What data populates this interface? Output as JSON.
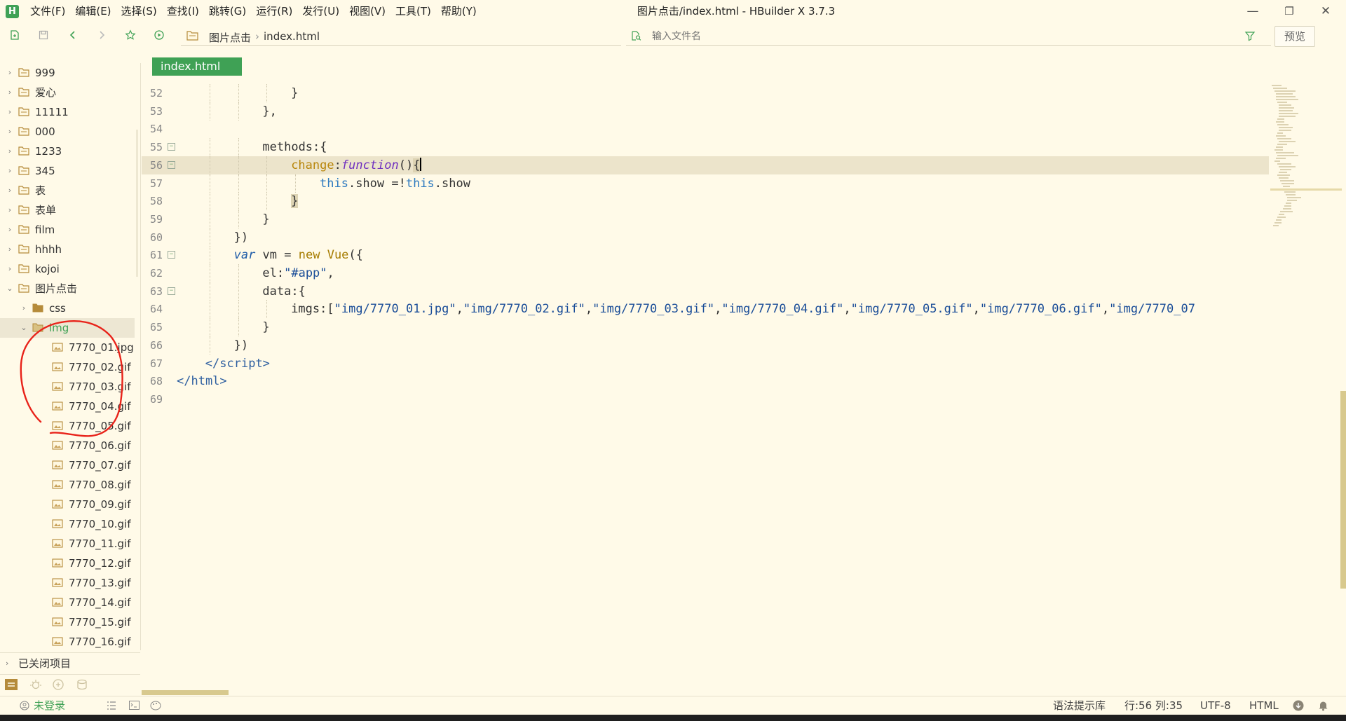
{
  "app": {
    "logo_letter": "H",
    "window_title": "图片点击/index.html - HBuilder X 3.7.3",
    "accent_color": "#3fa155"
  },
  "menu": [
    "文件(F)",
    "编辑(E)",
    "选择(S)",
    "查找(I)",
    "跳转(G)",
    "运行(R)",
    "发行(U)",
    "视图(V)",
    "工具(T)",
    "帮助(Y)"
  ],
  "window_controls": {
    "minimize": "—",
    "restore": "❐",
    "close": "✕"
  },
  "toolbar": {
    "breadcrumb": [
      "图片点击",
      "index.html"
    ],
    "breadcrumb_separator": "›",
    "search_placeholder": "输入文件名",
    "preview_label": "预览"
  },
  "sidebar": {
    "tree": [
      {
        "label": "999",
        "kind": "folder",
        "expanded": false,
        "depth": 0
      },
      {
        "label": "爱心",
        "kind": "folder",
        "expanded": false,
        "depth": 0
      },
      {
        "label": "11111",
        "kind": "folder",
        "expanded": false,
        "depth": 0
      },
      {
        "label": "000",
        "kind": "folder",
        "expanded": false,
        "depth": 0
      },
      {
        "label": "1233",
        "kind": "folder",
        "expanded": false,
        "depth": 0
      },
      {
        "label": "345",
        "kind": "folder",
        "expanded": false,
        "depth": 0
      },
      {
        "label": "表",
        "kind": "folder",
        "expanded": false,
        "depth": 0
      },
      {
        "label": "表单",
        "kind": "folder",
        "expanded": false,
        "depth": 0
      },
      {
        "label": "film",
        "kind": "folder",
        "expanded": false,
        "depth": 0
      },
      {
        "label": "hhhh",
        "kind": "folder",
        "expanded": false,
        "depth": 0
      },
      {
        "label": "kojoi",
        "kind": "folder",
        "expanded": false,
        "depth": 0
      },
      {
        "label": "图片点击",
        "kind": "folder",
        "expanded": true,
        "depth": 0
      },
      {
        "label": "css",
        "kind": "folder",
        "expanded": false,
        "depth": 1
      },
      {
        "label": "img",
        "kind": "folder",
        "expanded": true,
        "depth": 1,
        "selected": true
      },
      {
        "label": "7770_01.jpg",
        "kind": "image",
        "depth": 2
      },
      {
        "label": "7770_02.gif",
        "kind": "image",
        "depth": 2
      },
      {
        "label": "7770_03.gif",
        "kind": "image",
        "depth": 2
      },
      {
        "label": "7770_04.gif",
        "kind": "image",
        "depth": 2
      },
      {
        "label": "7770_05.gif",
        "kind": "image",
        "depth": 2
      },
      {
        "label": "7770_06.gif",
        "kind": "image",
        "depth": 2
      },
      {
        "label": "7770_07.gif",
        "kind": "image",
        "depth": 2
      },
      {
        "label": "7770_08.gif",
        "kind": "image",
        "depth": 2
      },
      {
        "label": "7770_09.gif",
        "kind": "image",
        "depth": 2
      },
      {
        "label": "7770_10.gif",
        "kind": "image",
        "depth": 2
      },
      {
        "label": "7770_11.gif",
        "kind": "image",
        "depth": 2
      },
      {
        "label": "7770_12.gif",
        "kind": "image",
        "depth": 2
      },
      {
        "label": "7770_13.gif",
        "kind": "image",
        "depth": 2
      },
      {
        "label": "7770_14.gif",
        "kind": "image",
        "depth": 2
      },
      {
        "label": "7770_15.gif",
        "kind": "image",
        "depth": 2
      },
      {
        "label": "7770_16.gif",
        "kind": "image",
        "depth": 2
      }
    ],
    "closed_projects_label": "已关闭项目"
  },
  "editor": {
    "tab_label": "index.html",
    "lines": [
      {
        "num": "52",
        "indent": 4,
        "html": "}"
      },
      {
        "num": "53",
        "indent": 3,
        "html": "},"
      },
      {
        "num": "54",
        "indent": 0,
        "html": ""
      },
      {
        "num": "55",
        "indent": 3,
        "fold": true,
        "html": "methods:{"
      },
      {
        "num": "56",
        "indent": 4,
        "fold": true,
        "active": true,
        "html": "<span class=\"prop\">change</span>:<span class=\"kw-fn\">function</span>()<span class=\"paren-hl\">{</span><span id=\"cursor\"></span>"
      },
      {
        "num": "57",
        "indent": 5,
        "html": "<span class=\"kw-this\">this</span>.show =!<span class=\"kw-this\">this</span>.show"
      },
      {
        "num": "58",
        "indent": 4,
        "html": "<span class=\"paren-hl\">}</span>"
      },
      {
        "num": "59",
        "indent": 3,
        "html": "}"
      },
      {
        "num": "60",
        "indent": 2,
        "html": "})"
      },
      {
        "num": "61",
        "indent": 2,
        "fold": true,
        "html": "<span class=\"kw-var\">var</span> vm = <span class=\"kw-new\">new</span> <span class=\"kw-new\">Vue</span>({"
      },
      {
        "num": "62",
        "indent": 3,
        "html": "el:<span class=\"str\">\"#app\"</span>,"
      },
      {
        "num": "63",
        "indent": 3,
        "fold": true,
        "html": "data:{"
      },
      {
        "num": "64",
        "indent": 4,
        "html": "imgs:[<span class=\"str\">\"img/7770_01.jpg\"</span>,<span class=\"str\">\"img/7770_02.gif\"</span>,<span class=\"str\">\"img/7770_03.gif\"</span>,<span class=\"str\">\"img/7770_04.gif\"</span>,<span class=\"str\">\"img/7770_05.gif\"</span>,<span class=\"str\">\"img/7770_06.gif\"</span>,<span class=\"str\">\"img/7770_07</span>"
      },
      {
        "num": "65",
        "indent": 3,
        "html": "}"
      },
      {
        "num": "66",
        "indent": 2,
        "html": "})"
      },
      {
        "num": "67",
        "indent": 1,
        "html": "<span class=\"tag\">&lt;/script&gt;</span>"
      },
      {
        "num": "68",
        "indent": 0,
        "html": "<span class=\"tag\">&lt;/html&gt;</span>"
      },
      {
        "num": "69",
        "indent": 0,
        "html": ""
      }
    ]
  },
  "status": {
    "login": "未登录",
    "hint_library": "语法提示库",
    "position": "行:56  列:35",
    "encoding": "UTF-8",
    "language": "HTML"
  }
}
